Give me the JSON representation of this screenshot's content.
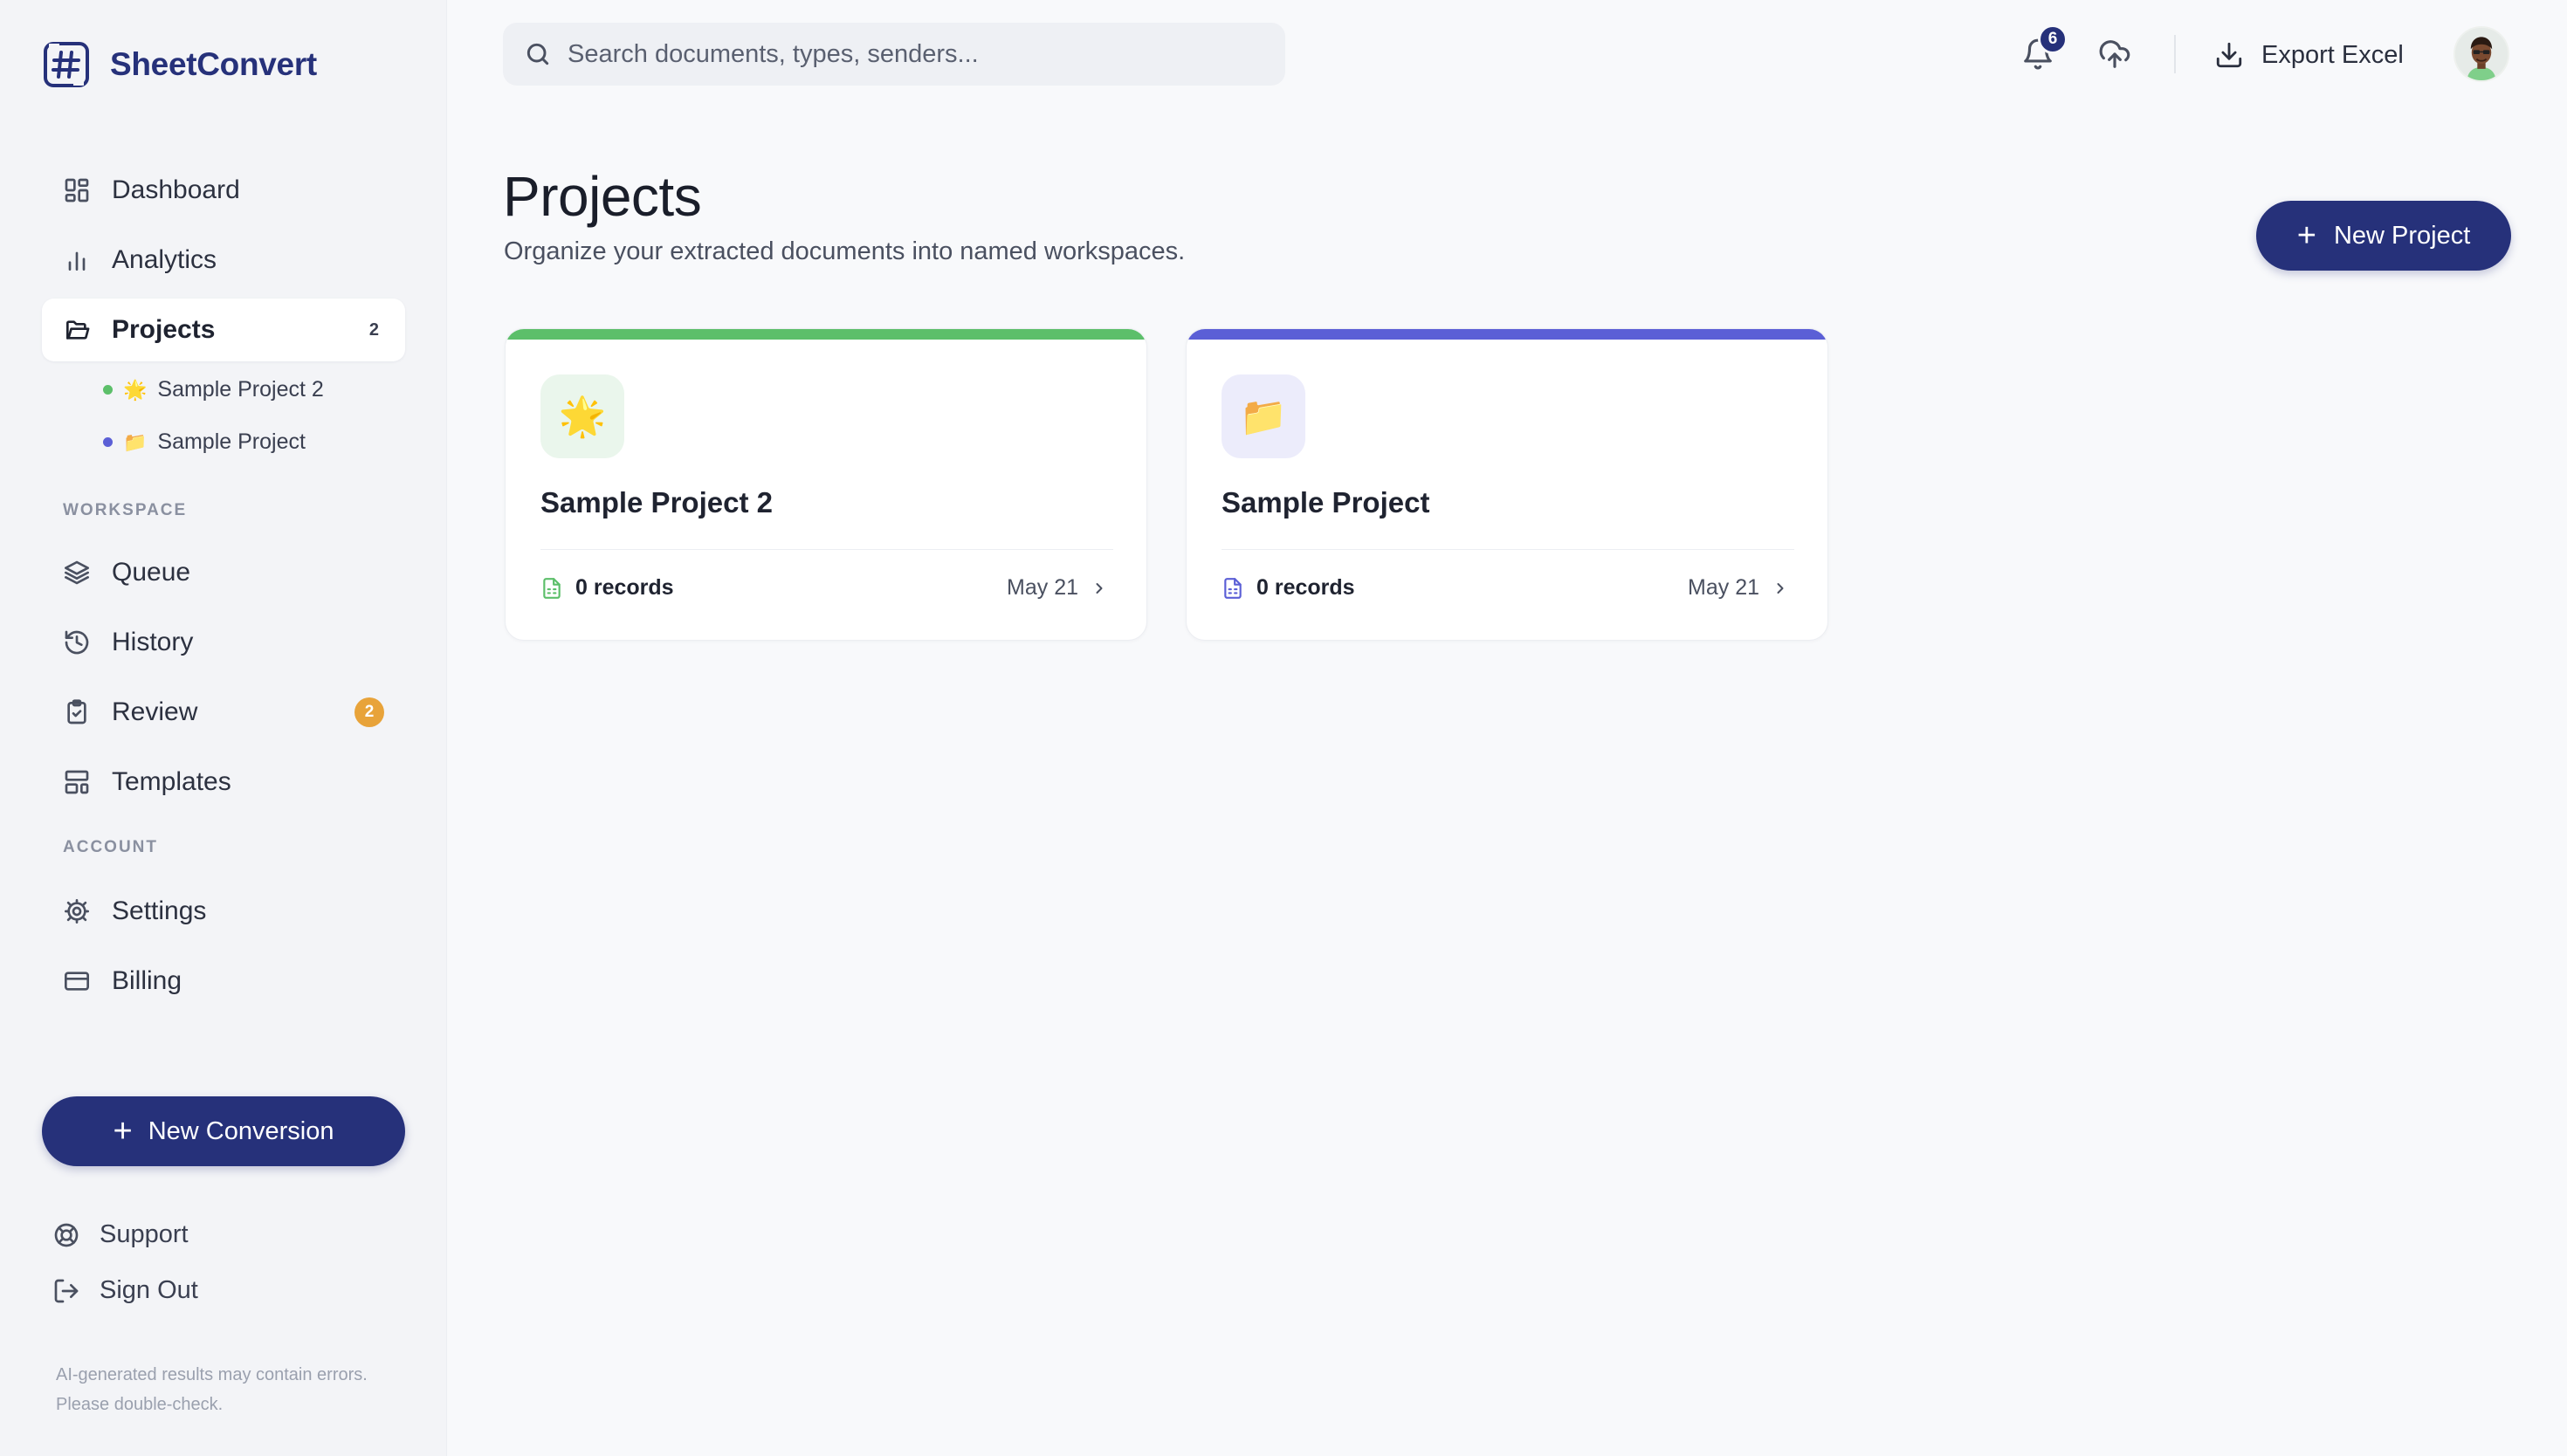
{
  "app": {
    "name": "SheetConvert"
  },
  "colors": {
    "brand": "#26317a",
    "green": "#5cbf6a",
    "indigo": "#5b5fd6",
    "orange": "#e8a33a"
  },
  "sidebar": {
    "nav": [
      {
        "id": "dashboard",
        "label": "Dashboard",
        "icon": "dashboard-icon"
      },
      {
        "id": "analytics",
        "label": "Analytics",
        "icon": "bar-chart-icon"
      },
      {
        "id": "projects",
        "label": "Projects",
        "icon": "folder-open-icon",
        "count": "2",
        "active": true
      }
    ],
    "projects": [
      {
        "label": "Sample Project 2",
        "emoji": "🌟",
        "dot_color": "#5cbf6a"
      },
      {
        "label": "Sample Project",
        "emoji": "📁",
        "dot_color": "#5b5fd6"
      }
    ],
    "workspace_label": "WORKSPACE",
    "workspace": [
      {
        "id": "queue",
        "label": "Queue",
        "icon": "layers-icon"
      },
      {
        "id": "history",
        "label": "History",
        "icon": "history-icon"
      },
      {
        "id": "review",
        "label": "Review",
        "icon": "clipboard-check-icon",
        "count": "2"
      },
      {
        "id": "templates",
        "label": "Templates",
        "icon": "layout-template-icon"
      }
    ],
    "account_label": "ACCOUNT",
    "account": [
      {
        "id": "settings",
        "label": "Settings",
        "icon": "gear-icon"
      },
      {
        "id": "billing",
        "label": "Billing",
        "icon": "credit-card-icon"
      }
    ],
    "new_conversion": "New Conversion",
    "support": "Support",
    "sign_out": "Sign Out",
    "disclaimer": "AI-generated results may contain errors. Please double-check."
  },
  "topbar": {
    "search_placeholder": "Search documents, types, senders...",
    "notifications_count": "6",
    "export_label": "Export Excel"
  },
  "main": {
    "title": "Projects",
    "subtitle": "Organize your extracted documents into named workspaces.",
    "new_project": "New Project",
    "cards": [
      {
        "title": "Sample Project 2",
        "emoji": "🌟",
        "accent": "#5cbf6a",
        "tint": "#eaf6ec",
        "records": "0 records",
        "date": "May 21"
      },
      {
        "title": "Sample Project",
        "emoji": "📁",
        "accent": "#5b5fd6",
        "tint": "#ececfb",
        "records": "0 records",
        "date": "May 21"
      }
    ]
  }
}
